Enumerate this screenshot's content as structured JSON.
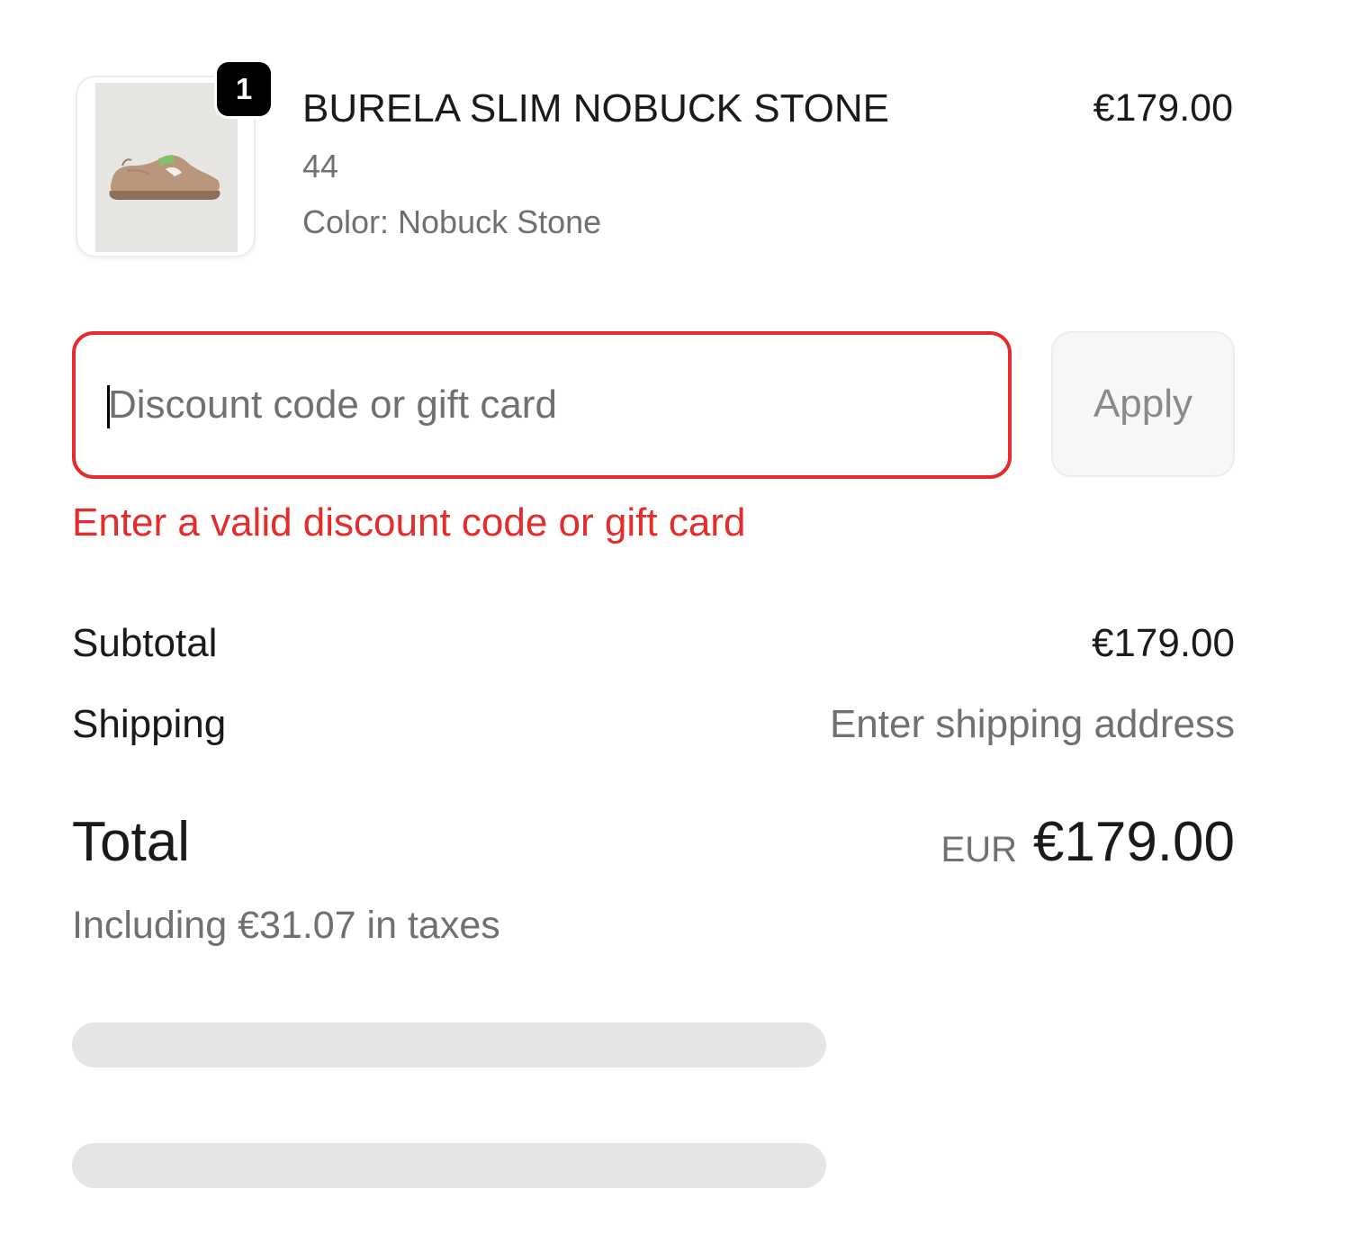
{
  "line_item": {
    "name": "BURELA SLIM NOBUCK STONE",
    "size": "44",
    "color": "Color: Nobuck Stone",
    "price": "€179.00",
    "quantity": "1",
    "image_icon": "sneaker-product-image"
  },
  "discount": {
    "placeholder": "Discount code or gift card",
    "value": "",
    "apply_label": "Apply",
    "error": "Enter a valid discount code or gift card",
    "error_color": "#e32c2b"
  },
  "summary": {
    "subtotal_label": "Subtotal",
    "subtotal_value": "€179.00",
    "shipping_label": "Shipping",
    "shipping_value": "Enter shipping address",
    "total_label": "Total",
    "total_currency": "EUR",
    "total_value": "€179.00",
    "tax_note": "Including €31.07 in taxes"
  }
}
